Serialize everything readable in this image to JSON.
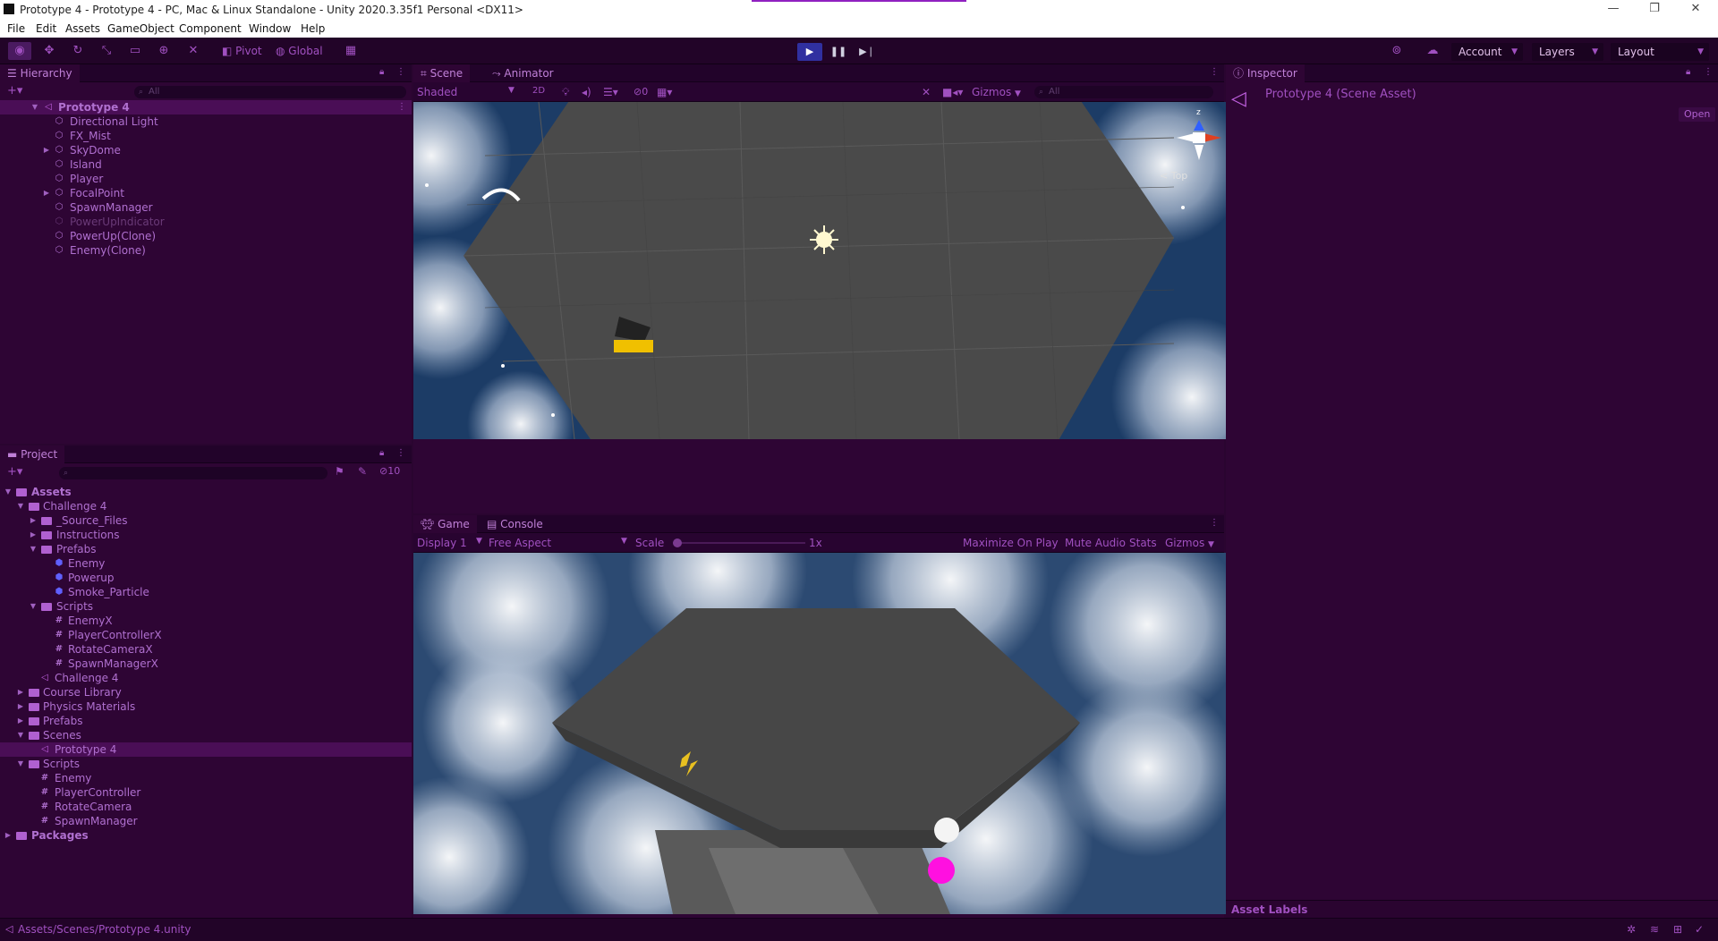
{
  "window": {
    "title": "Prototype 4 - Prototype 4 - PC, Mac & Linux Standalone - Unity 2020.3.35f1 Personal <DX11>"
  },
  "menu": [
    "File",
    "Edit",
    "Assets",
    "GameObject",
    "Component",
    "Window",
    "Help"
  ],
  "toolbar": {
    "pivot": "Pivot",
    "global": "Global",
    "account": "Account",
    "layers": "Layers",
    "layout": "Layout"
  },
  "hierarchy": {
    "tab": "Hierarchy",
    "search_placeholder": "All",
    "scene_name": "Prototype 4",
    "items": [
      "Directional Light",
      "FX_Mist",
      "SkyDome",
      "Island",
      "Player",
      "FocalPoint",
      "SpawnManager",
      "PowerUpIndicator",
      "PowerUp(Clone)",
      "Enemy(Clone)"
    ]
  },
  "project": {
    "tab": "Project",
    "hidden_count": "10",
    "tree": {
      "assets": "Assets",
      "challenge4": "Challenge 4",
      "source_files": "_Source_Files",
      "instructions": "Instructions",
      "prefabs": "Prefabs",
      "enemy_prefab": "Enemy",
      "powerup_prefab": "Powerup",
      "smoke": "Smoke_Particle",
      "scripts": "Scripts",
      "enemyx": "EnemyX",
      "playerx": "PlayerControllerX",
      "rotatex": "RotateCameraX",
      "spawnx": "SpawnManagerX",
      "challenge4_scene": "Challenge 4",
      "course_library": "Course Library",
      "physics": "Physics Materials",
      "prefabs2": "Prefabs",
      "scenes": "Scenes",
      "prototype4_scene": "Prototype 4",
      "scripts2": "Scripts",
      "enemy_script": "Enemy",
      "player_script": "PlayerController",
      "rotate_script": "RotateCamera",
      "spawn_script": "SpawnManager",
      "packages": "Packages"
    }
  },
  "scene": {
    "tab_scene": "Scene",
    "tab_animator": "Animator",
    "shading": "Shaded",
    "mode_2d": "2D",
    "hidden_count": "0",
    "gizmos": "Gizmos",
    "search_placeholder": "All",
    "gizmo_label": "Top",
    "axis_z": "z"
  },
  "game": {
    "tab_game": "Game",
    "tab_console": "Console",
    "display": "Display 1",
    "aspect": "Free Aspect",
    "scale_label": "Scale",
    "scale_value": "1x",
    "scale_level": 0.0,
    "maximize": "Maximize On Play",
    "mute": "Mute Audio",
    "stats": "Stats",
    "gizmos": "Gizmos"
  },
  "inspector": {
    "tab": "Inspector",
    "asset_title": "Prototype 4 (Scene Asset)",
    "open_button": "Open",
    "asset_labels": "Asset Labels"
  },
  "status": {
    "path": "Assets/Scenes/Prototype 4.unity"
  },
  "colors": {
    "accent": "#a050c0",
    "panel": "#2e0534",
    "play": "#3030a0"
  }
}
